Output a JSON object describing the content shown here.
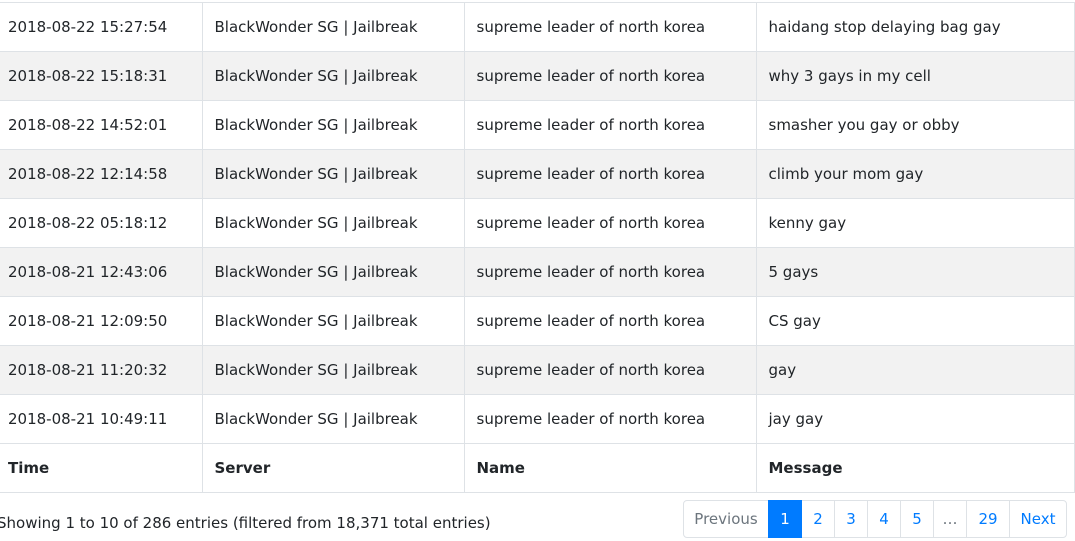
{
  "table": {
    "headers": {
      "time": "Time",
      "server": "Server",
      "name": "Name",
      "message": "Message"
    },
    "rows": [
      {
        "time": "2018-08-22 15:27:54",
        "server": "BlackWonder SG | Jailbreak",
        "name": "supreme leader of north korea",
        "message": "haidang stop delaying bag gay"
      },
      {
        "time": "2018-08-22 15:18:31",
        "server": "BlackWonder SG | Jailbreak",
        "name": "supreme leader of north korea",
        "message": "why 3 gays in my cell"
      },
      {
        "time": "2018-08-22 14:52:01",
        "server": "BlackWonder SG | Jailbreak",
        "name": "supreme leader of north korea",
        "message": "smasher you gay or obby"
      },
      {
        "time": "2018-08-22 12:14:58",
        "server": "BlackWonder SG | Jailbreak",
        "name": "supreme leader of north korea",
        "message": "climb your mom gay"
      },
      {
        "time": "2018-08-22 05:18:12",
        "server": "BlackWonder SG | Jailbreak",
        "name": "supreme leader of north korea",
        "message": "kenny gay"
      },
      {
        "time": "2018-08-21 12:43:06",
        "server": "BlackWonder SG | Jailbreak",
        "name": "supreme leader of north korea",
        "message": "5 gays"
      },
      {
        "time": "2018-08-21 12:09:50",
        "server": "BlackWonder SG | Jailbreak",
        "name": "supreme leader of north korea",
        "message": "CS gay"
      },
      {
        "time": "2018-08-21 11:20:32",
        "server": "BlackWonder SG | Jailbreak",
        "name": "supreme leader of north korea",
        "message": "gay"
      },
      {
        "time": "2018-08-21 10:49:11",
        "server": "BlackWonder SG | Jailbreak",
        "name": "supreme leader of north korea",
        "message": "jay gay"
      }
    ]
  },
  "info": {
    "text": "Showing 1 to 10 of 286 entries (filtered from 18,371 total entries)"
  },
  "pagination": {
    "previous": "Previous",
    "pages": [
      "1",
      "2",
      "3",
      "4",
      "5"
    ],
    "active_page": "1",
    "ellipsis": "…",
    "last_page": "29",
    "next": "Next"
  },
  "colors": {
    "accent": "#007bff",
    "stripe": "#f2f2f2",
    "border": "#dee2e6"
  }
}
